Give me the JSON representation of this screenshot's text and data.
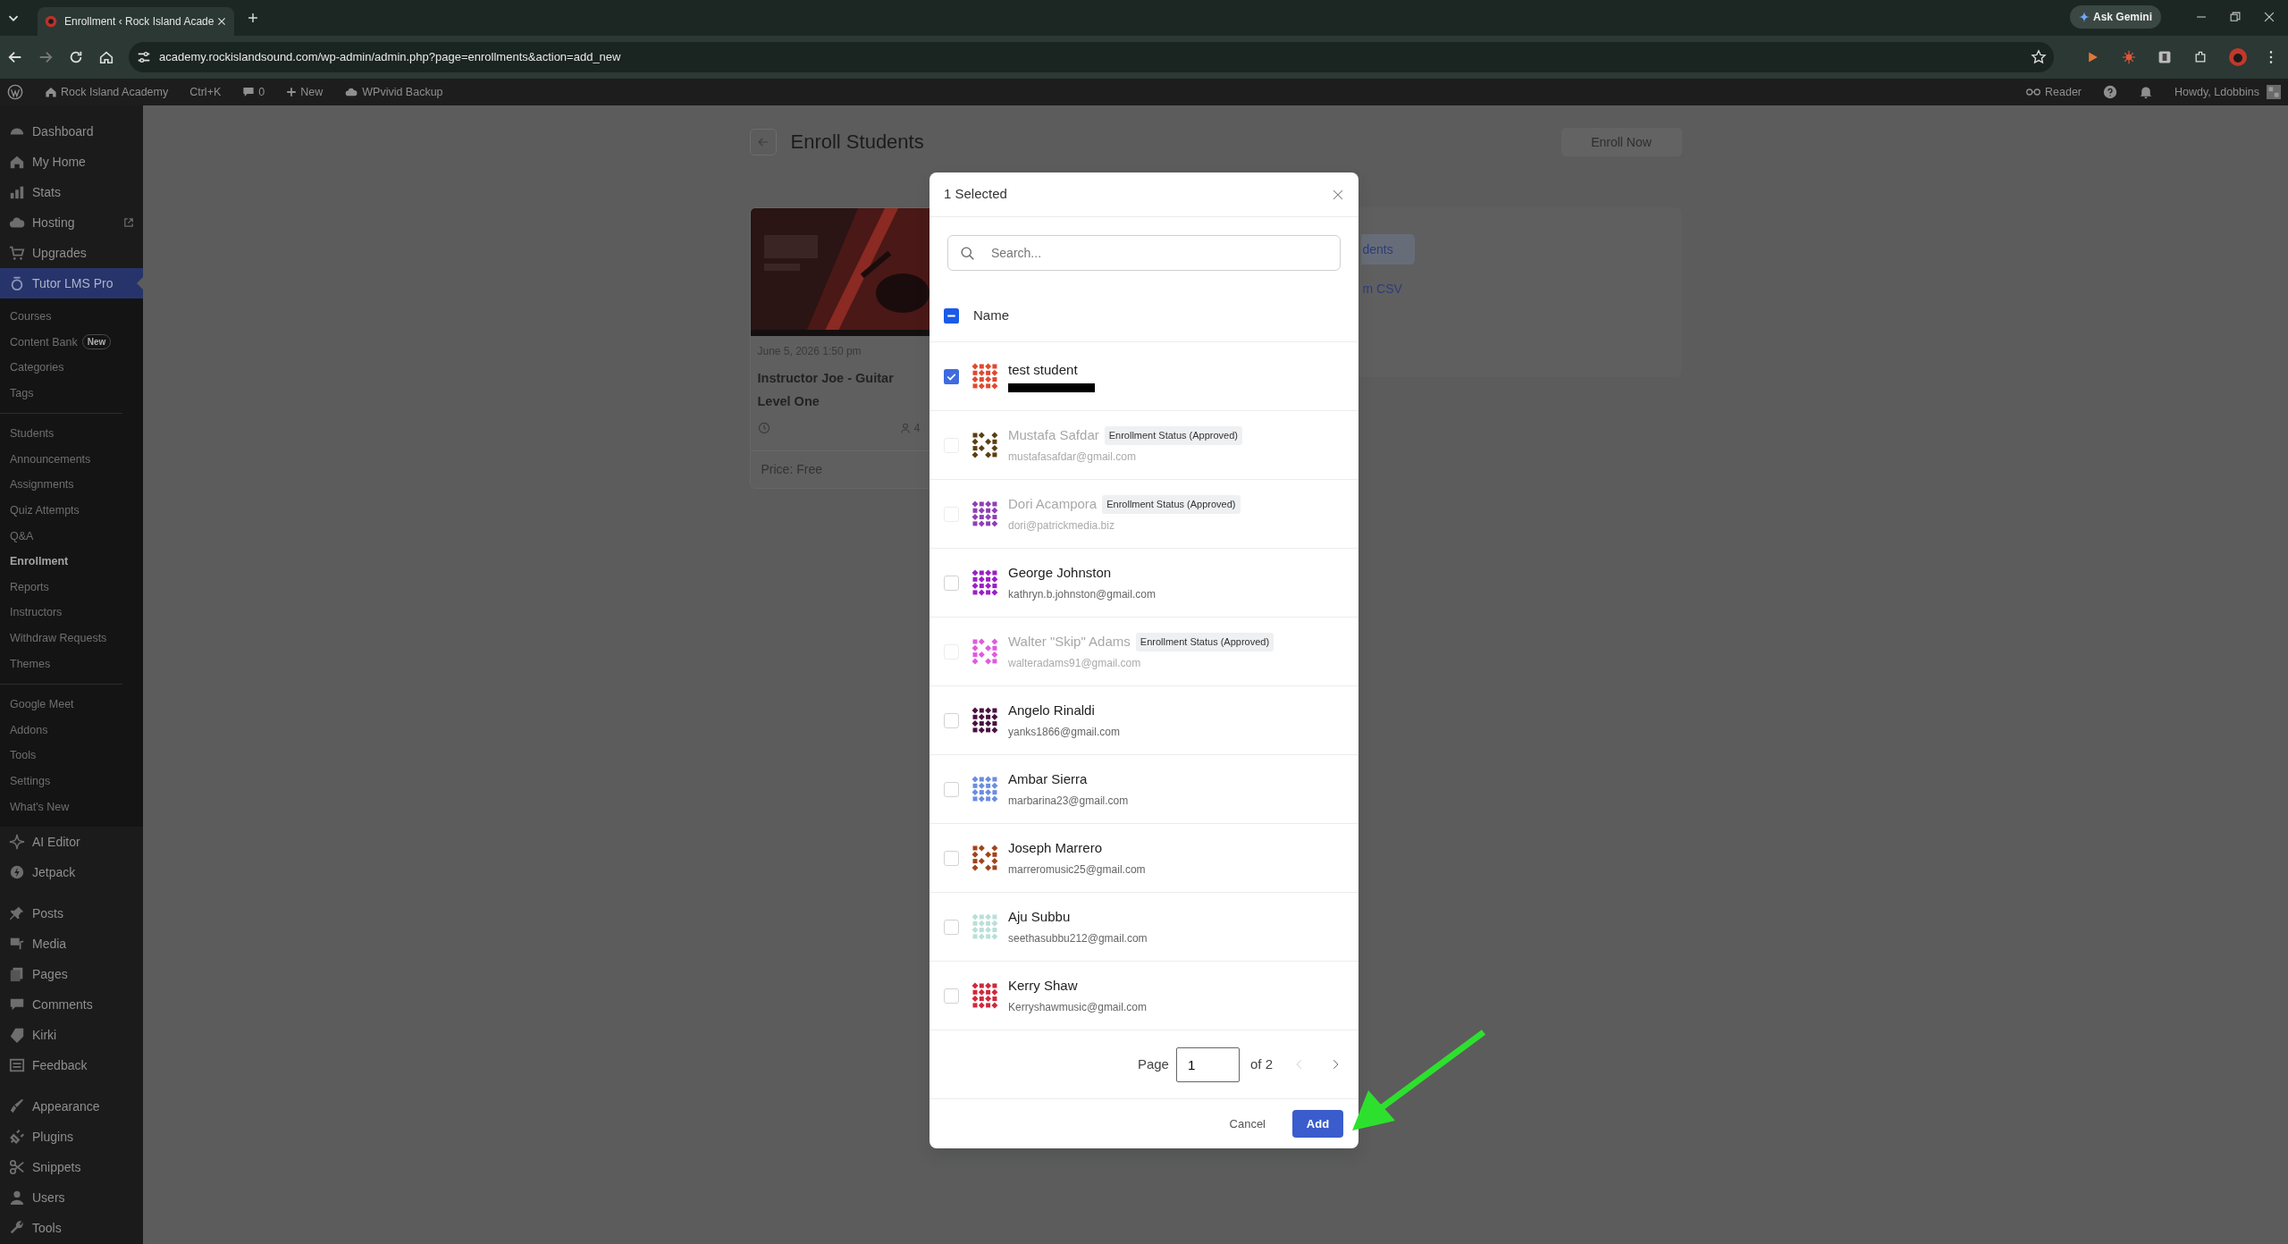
{
  "browser": {
    "tab_title": "Enrollment ‹ Rock Island Acade",
    "url": "academy.rockislandsound.com/wp-admin/admin.php?page=enrollments&action=add_new",
    "gemini_button": "Ask Gemini"
  },
  "admin_bar": {
    "site": "Rock Island Academy",
    "shortcut": "Ctrl+K",
    "comments": "0",
    "new": "New",
    "backup": "WPvivid Backup",
    "reader": "Reader",
    "greeting": "Howdy, Ldobbins"
  },
  "sidebar": {
    "items": [
      {
        "label": "Dashboard",
        "selected": false,
        "external": false,
        "separator_before": false
      },
      {
        "label": "My Home",
        "selected": false,
        "external": false,
        "separator_before": false
      },
      {
        "label": "Stats",
        "selected": false,
        "external": false,
        "separator_before": false
      },
      {
        "label": "Hosting",
        "selected": false,
        "external": true,
        "separator_before": false
      },
      {
        "label": "Upgrades",
        "selected": false,
        "external": false,
        "separator_before": false
      },
      {
        "label": "Tutor LMS Pro",
        "selected": true,
        "external": false,
        "separator_before": false,
        "children": [
          {
            "label": "Courses",
            "selected": false,
            "divider_before": false
          },
          {
            "label": "Content Bank",
            "badge": "New",
            "selected": false,
            "divider_before": false
          },
          {
            "label": "Categories",
            "selected": false,
            "divider_before": false
          },
          {
            "label": "Tags",
            "selected": false,
            "divider_before": false
          },
          {
            "label": "Students",
            "selected": false,
            "divider_before": true
          },
          {
            "label": "Announcements",
            "selected": false,
            "divider_before": false
          },
          {
            "label": "Assignments",
            "selected": false,
            "divider_before": false
          },
          {
            "label": "Quiz Attempts",
            "selected": false,
            "divider_before": false
          },
          {
            "label": "Q&A",
            "selected": false,
            "divider_before": false
          },
          {
            "label": "Enrollment",
            "selected": true,
            "divider_before": false
          },
          {
            "label": "Reports",
            "selected": false,
            "divider_before": false
          },
          {
            "label": "Instructors",
            "selected": false,
            "divider_before": false
          },
          {
            "label": "Withdraw Requests",
            "selected": false,
            "divider_before": false
          },
          {
            "label": "Themes",
            "selected": false,
            "divider_before": false
          },
          {
            "label": "Google Meet",
            "selected": false,
            "divider_before": true
          },
          {
            "label": "Addons",
            "selected": false,
            "divider_before": false
          },
          {
            "label": "Tools",
            "selected": false,
            "divider_before": false
          },
          {
            "label": "Settings",
            "selected": false,
            "divider_before": false
          },
          {
            "label": "What's New",
            "selected": false,
            "divider_before": false
          }
        ]
      },
      {
        "label": "AI Editor",
        "selected": false,
        "external": false,
        "separator_before": false
      },
      {
        "label": "Jetpack",
        "selected": false,
        "external": false,
        "separator_before": false
      },
      {
        "label": "Posts",
        "selected": false,
        "external": false,
        "separator_before": true
      },
      {
        "label": "Media",
        "selected": false,
        "external": false,
        "separator_before": false
      },
      {
        "label": "Pages",
        "selected": false,
        "external": false,
        "separator_before": false
      },
      {
        "label": "Comments",
        "selected": false,
        "external": false,
        "separator_before": false
      },
      {
        "label": "Kirki",
        "selected": false,
        "external": false,
        "separator_before": false
      },
      {
        "label": "Feedback",
        "selected": false,
        "external": false,
        "separator_before": false
      },
      {
        "label": "Appearance",
        "selected": false,
        "external": false,
        "separator_before": true
      },
      {
        "label": "Plugins",
        "selected": false,
        "external": false,
        "separator_before": false
      },
      {
        "label": "Snippets",
        "selected": false,
        "external": false,
        "separator_before": false
      },
      {
        "label": "Users",
        "selected": false,
        "external": false,
        "separator_before": false
      },
      {
        "label": "Tools",
        "selected": false,
        "external": false,
        "separator_before": false
      }
    ]
  },
  "page": {
    "title": "Enroll Students",
    "enroll_button": "Enroll Now",
    "course": {
      "kind": "picture",
      "date": "June 5, 2026 1:50 pm",
      "title": "Instructor Joe - Guitar Level One",
      "students": "4",
      "price_label": "Price:",
      "price": "Free"
    },
    "options": [
      {
        "label": "dents",
        "selected": true
      },
      {
        "label": "m CSV",
        "selected": false
      }
    ]
  },
  "modal": {
    "title": "1 Selected",
    "search": {
      "placeholder": "Search..."
    },
    "header": {
      "label": "Name",
      "indeterminate": true
    },
    "students": [
      {
        "name": "test student",
        "email_redacted": true,
        "checked": true,
        "disabled": false,
        "color": "#e0482f"
      },
      {
        "name": "Mustafa Safdar",
        "badge": "Enrollment Status (Approved)",
        "email": "mustafasafdar@gmail.com",
        "email_redacted": false,
        "checked": false,
        "disabled": true,
        "color": "#5a3f12"
      },
      {
        "name": "Dori Acampora",
        "badge": "Enrollment Status (Approved)",
        "email": "dori@patrickmedia.biz",
        "email_redacted": false,
        "checked": false,
        "disabled": true,
        "color": "#8e3fb5"
      },
      {
        "name": "George Johnston",
        "email": "kathryn.b.johnston@gmail.com",
        "email_redacted": false,
        "checked": false,
        "disabled": false,
        "color": "#9a1fc4"
      },
      {
        "name": "Walter \"Skip\" Adams",
        "badge": "Enrollment Status (Approved)",
        "email": "walteradams91@gmail.com",
        "email_redacted": false,
        "checked": false,
        "disabled": true,
        "color": "#e05ae0"
      },
      {
        "name": "Angelo Rinaldi",
        "email": "yanks1866@gmail.com",
        "email_redacted": false,
        "checked": false,
        "disabled": false,
        "color": "#4a1040"
      },
      {
        "name": "Ambar Sierra",
        "email": "marbarina23@gmail.com",
        "email_redacted": false,
        "checked": false,
        "disabled": false,
        "color": "#6b8de0"
      },
      {
        "name": "Joseph Marrero",
        "email": "marreromusic25@gmail.com",
        "email_redacted": false,
        "checked": false,
        "disabled": false,
        "color": "#a0441c"
      },
      {
        "name": "Aju Subbu",
        "email": "seethasubbu212@gmail.com",
        "email_redacted": false,
        "checked": false,
        "disabled": false,
        "color": "#b8e0d8"
      },
      {
        "name": "Kerry Shaw",
        "email": "Kerryshawmusic@gmail.com",
        "email_redacted": false,
        "checked": false,
        "disabled": false,
        "color": "#d0283c"
      }
    ],
    "pagination": {
      "label": "Page",
      "value": "1",
      "total": "of 2",
      "prev_disabled": true,
      "next_disabled": false
    },
    "cancel_button": "Cancel",
    "add_button": "Add"
  }
}
